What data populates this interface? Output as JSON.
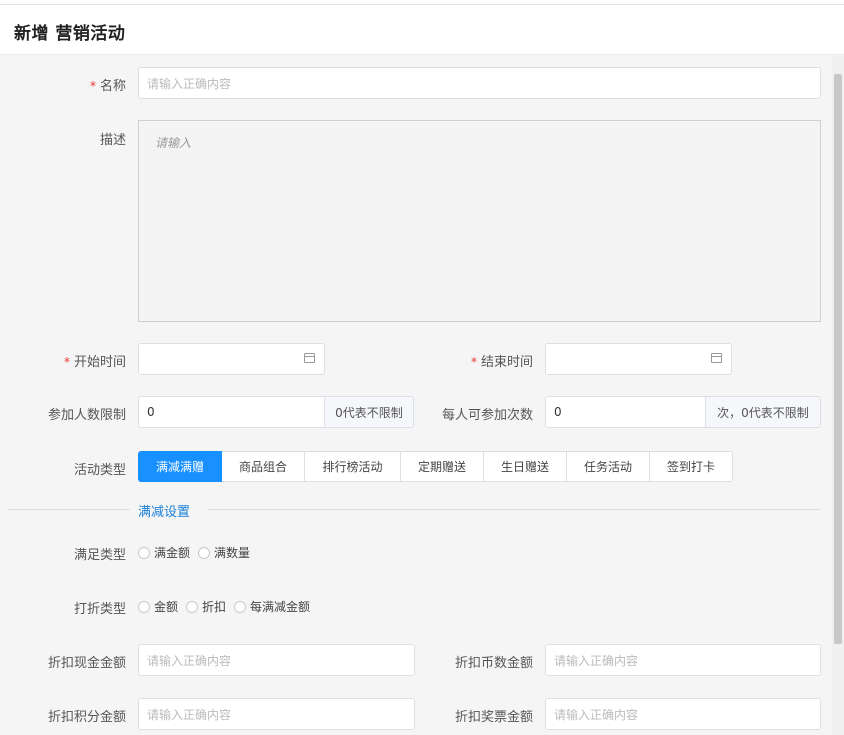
{
  "header": {
    "title": "新增 营销活动"
  },
  "form": {
    "name": {
      "label": "名称",
      "placeholder": "请输入正确内容"
    },
    "description": {
      "label": "描述",
      "placeholder": "请输入"
    },
    "start_time": {
      "label": "开始时间"
    },
    "end_time": {
      "label": "结束时间"
    },
    "participant_limit": {
      "label": "参加人数限制",
      "value": "0",
      "suffix": "0代表不限制"
    },
    "per_person_limit": {
      "label": "每人可参加次数",
      "value": "0",
      "suffix": "次，0代表不限制"
    },
    "activity_type": {
      "label": "活动类型",
      "options": [
        "满减满赠",
        "商品组合",
        "排行榜活动",
        "定期赠送",
        "生日赠送",
        "任务活动",
        "签到打卡"
      ],
      "selected": "满减满赠"
    },
    "section_title": "满减设置",
    "satisfy_type": {
      "label": "满足类型",
      "options": [
        "满金额",
        "满数量"
      ]
    },
    "discount_type": {
      "label": "打折类型",
      "options": [
        "金额",
        "折扣",
        "每满减金额"
      ]
    },
    "cash_discount": {
      "label": "折扣现金金额",
      "placeholder": "请输入正确内容"
    },
    "coin_discount": {
      "label": "折扣币数金额",
      "placeholder": "请输入正确内容"
    },
    "points_discount": {
      "label": "折扣积分金额",
      "placeholder": "请输入正确内容"
    },
    "ticket_discount": {
      "label": "折扣奖票金额",
      "placeholder": "请输入正确内容"
    }
  },
  "colors": {
    "primary": "#1890ff",
    "required": "#e33333",
    "section": "#1a7fd8"
  }
}
